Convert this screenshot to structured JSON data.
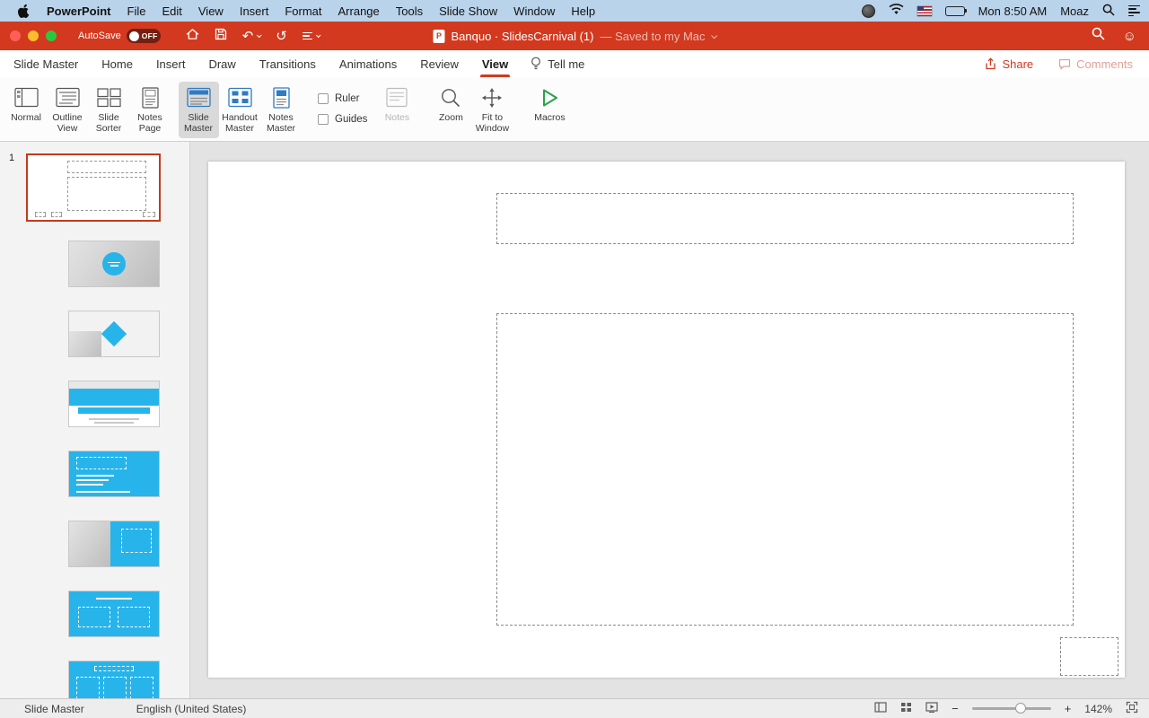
{
  "menubar": {
    "app_name": "PowerPoint",
    "items": [
      "File",
      "Edit",
      "View",
      "Insert",
      "Format",
      "Arrange",
      "Tools",
      "Slide Show",
      "Window",
      "Help"
    ],
    "clock": "Mon 8:50 AM",
    "user": "Moaz"
  },
  "titlebar": {
    "autosave_label": "AutoSave",
    "autosave_state": "OFF",
    "doc_badge": "P",
    "doc_title": "Banquo · SlidesCarnival (1)",
    "saved_status": "— Saved to my Mac"
  },
  "glyphs": {
    "undo": "↶",
    "redo": "↺",
    "smiley": "☺",
    "minus": "−",
    "plus": "+"
  },
  "tabs": {
    "items": [
      "Slide Master",
      "Home",
      "Insert",
      "Draw",
      "Transitions",
      "Animations",
      "Review",
      "View"
    ],
    "tell_me": "Tell me",
    "share": "Share",
    "comments": "Comments"
  },
  "ribbon": {
    "view_buttons": [
      {
        "label": "Normal"
      },
      {
        "label": "Outline View"
      },
      {
        "label": "Slide Sorter"
      },
      {
        "label": "Notes Page"
      }
    ],
    "master_buttons": [
      {
        "label": "Slide Master"
      },
      {
        "label": "Handout Master"
      },
      {
        "label": "Notes Master"
      }
    ],
    "checkboxes": [
      {
        "label": "Ruler"
      },
      {
        "label": "Guides"
      }
    ],
    "notes_label": "Notes",
    "zoom_label": "Zoom",
    "fit_label": "Fit to Window",
    "macros_label": "Macros"
  },
  "sidebar": {
    "slide_number": "1"
  },
  "statusbar": {
    "view_mode": "Slide Master",
    "language": "English (United States)",
    "zoom_level": "142%"
  }
}
